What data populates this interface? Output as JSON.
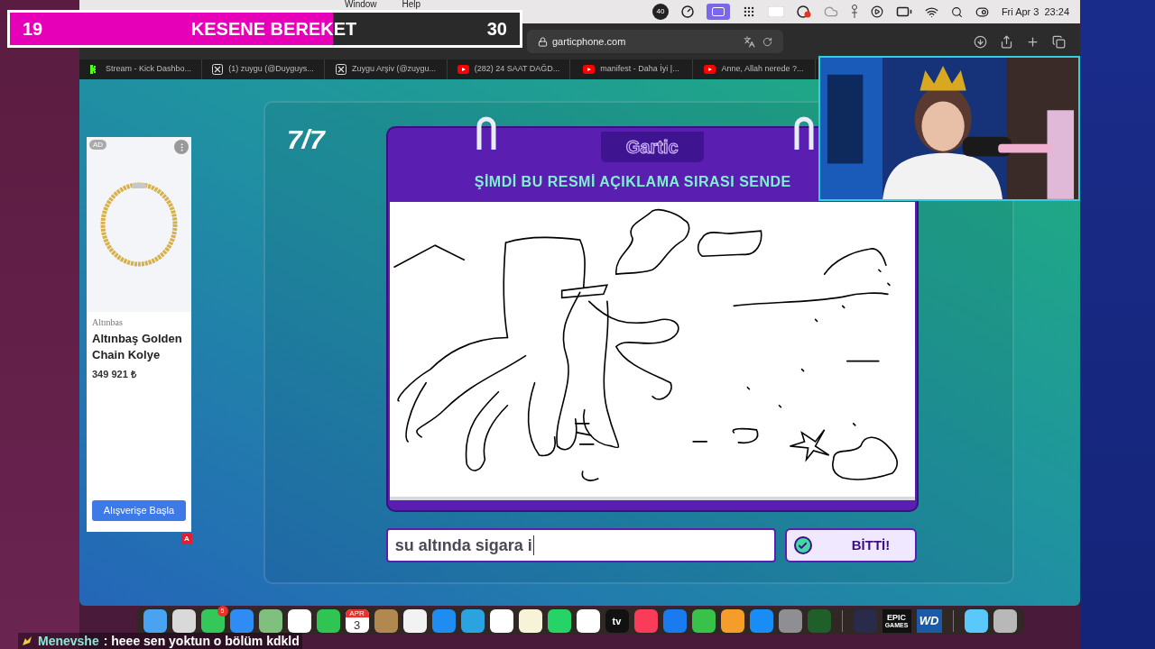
{
  "goal_bar": {
    "current": "19",
    "title": "KESENE BEREKET",
    "target": "30",
    "level": 0.633
  },
  "menubar": {
    "menus": [
      "Window",
      "Help"
    ],
    "badge": "40",
    "date": "Fri Apr 3",
    "time": "23:24"
  },
  "browser": {
    "address": "garticphone.com",
    "tabs": [
      {
        "kind": "kick",
        "title": "Stream - Kick Dashbo..."
      },
      {
        "kind": "x",
        "title": "(1) zuygu (@Duyguys..."
      },
      {
        "kind": "x",
        "title": "Zuygu Arşiv (@zuygu..."
      },
      {
        "kind": "youtube",
        "title": "(282) 24 SAAT DAĞD..."
      },
      {
        "kind": "youtube",
        "title": "manifest - Daha İyi |..."
      },
      {
        "kind": "youtube",
        "title": "Anne, Allah nerede ?..."
      }
    ]
  },
  "ad": {
    "badge": "AD",
    "brand": "Altınbas",
    "title": "Altınbaş Golden Chain Kolye",
    "price": "349 921 ₺",
    "button": "Alışverişe Başla",
    "corner": "A"
  },
  "game": {
    "round": "7/7",
    "logo": "Gartic",
    "prompt": "ŞİMDİ BU RESMİ AÇIKLAMA SIRASI SENDE",
    "answer": "su altında sigara i",
    "done_button": "BİTTİ!"
  },
  "dock": {
    "badge": "5",
    "calendar_month": "APR",
    "calendar_day": "3",
    "tv": "tv",
    "epic_top": "EPIC",
    "epic_bottom": "GAMES",
    "wd": "WD"
  },
  "chat": {
    "user": "Menevshe",
    "message": ": heee sen yoktun o bölüm kdkld"
  }
}
